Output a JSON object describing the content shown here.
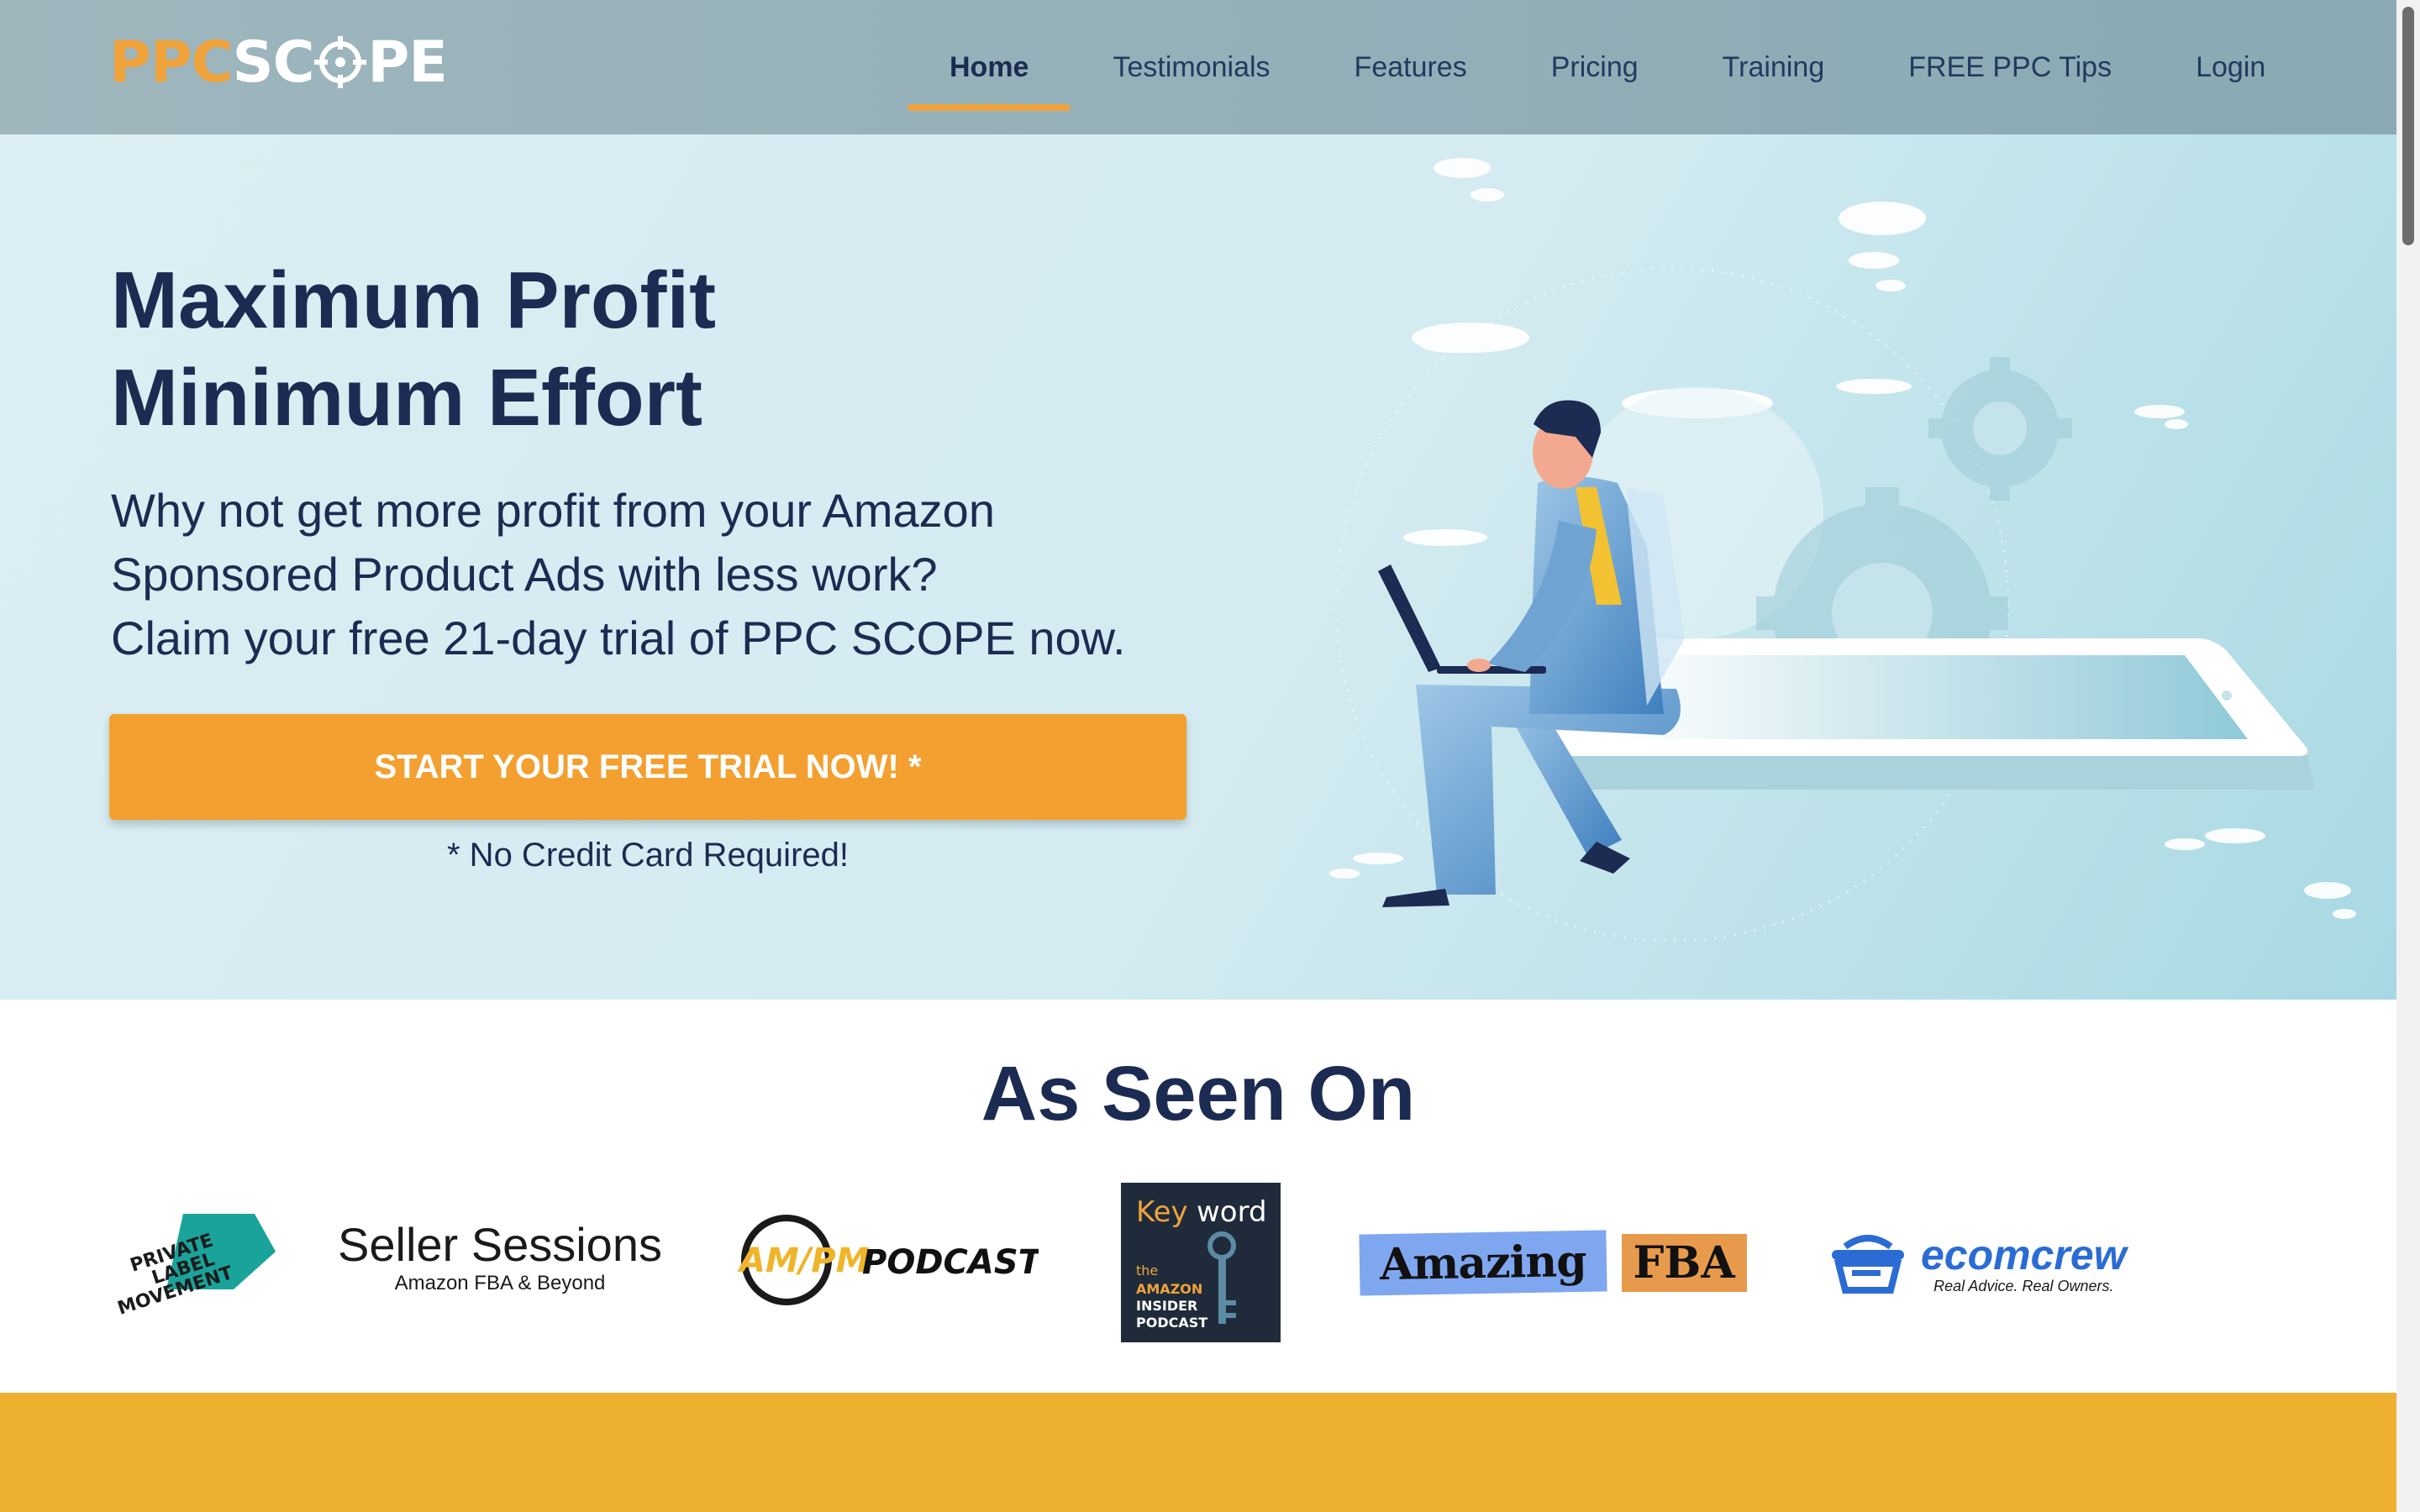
{
  "brand": {
    "logo_ppc": "PPC",
    "logo_scope_left": "SC",
    "logo_scope_right": "PE",
    "accent": "#f0a33a",
    "navy": "#1c2b52"
  },
  "nav": {
    "items": [
      {
        "label": "Home",
        "active": true
      },
      {
        "label": "Testimonials"
      },
      {
        "label": "Features"
      },
      {
        "label": "Pricing"
      },
      {
        "label": "Training"
      },
      {
        "label": "FREE PPC Tips"
      },
      {
        "label": "Login"
      }
    ]
  },
  "hero": {
    "title_line1": "Maximum Profit",
    "title_line2": "Minimum Effort",
    "sub_line1": "Why not get more profit from your Amazon",
    "sub_line2": "Sponsored Product Ads with less work?",
    "sub_line3": "Claim your free 21-day trial of PPC SCOPE now.",
    "cta_label": "START YOUR FREE TRIAL NOW! *",
    "cta_note": "* No Credit Card Required!",
    "illustration": "businessman-with-laptop-on-tablet-illustration"
  },
  "seen_on": {
    "title": "As Seen On",
    "logos": {
      "plm": {
        "l1": "PRIVATE",
        "l2": "LABEL",
        "l3": "MOVEMENT"
      },
      "seller_sessions": {
        "name": "Seller Sessions",
        "tagline": "Amazon FBA & Beyond"
      },
      "ampm": {
        "brand": "AM/PM",
        "word": "PODCAST"
      },
      "keyword": {
        "key": "Key",
        "word": "word",
        "l1": "the",
        "l2": "AMAZON",
        "l3": "INSIDER",
        "l4": "PODCAST"
      },
      "amazing_fba": {
        "amazing": "Amazing",
        "fba": "FBA"
      },
      "ecomcrew": {
        "name": "ecomcrew",
        "tagline": "Real Advice. Real Owners."
      }
    }
  },
  "colors": {
    "cta": "#f3a030",
    "band": "#eeb02f",
    "hero_bg": "#d3ebf1"
  }
}
